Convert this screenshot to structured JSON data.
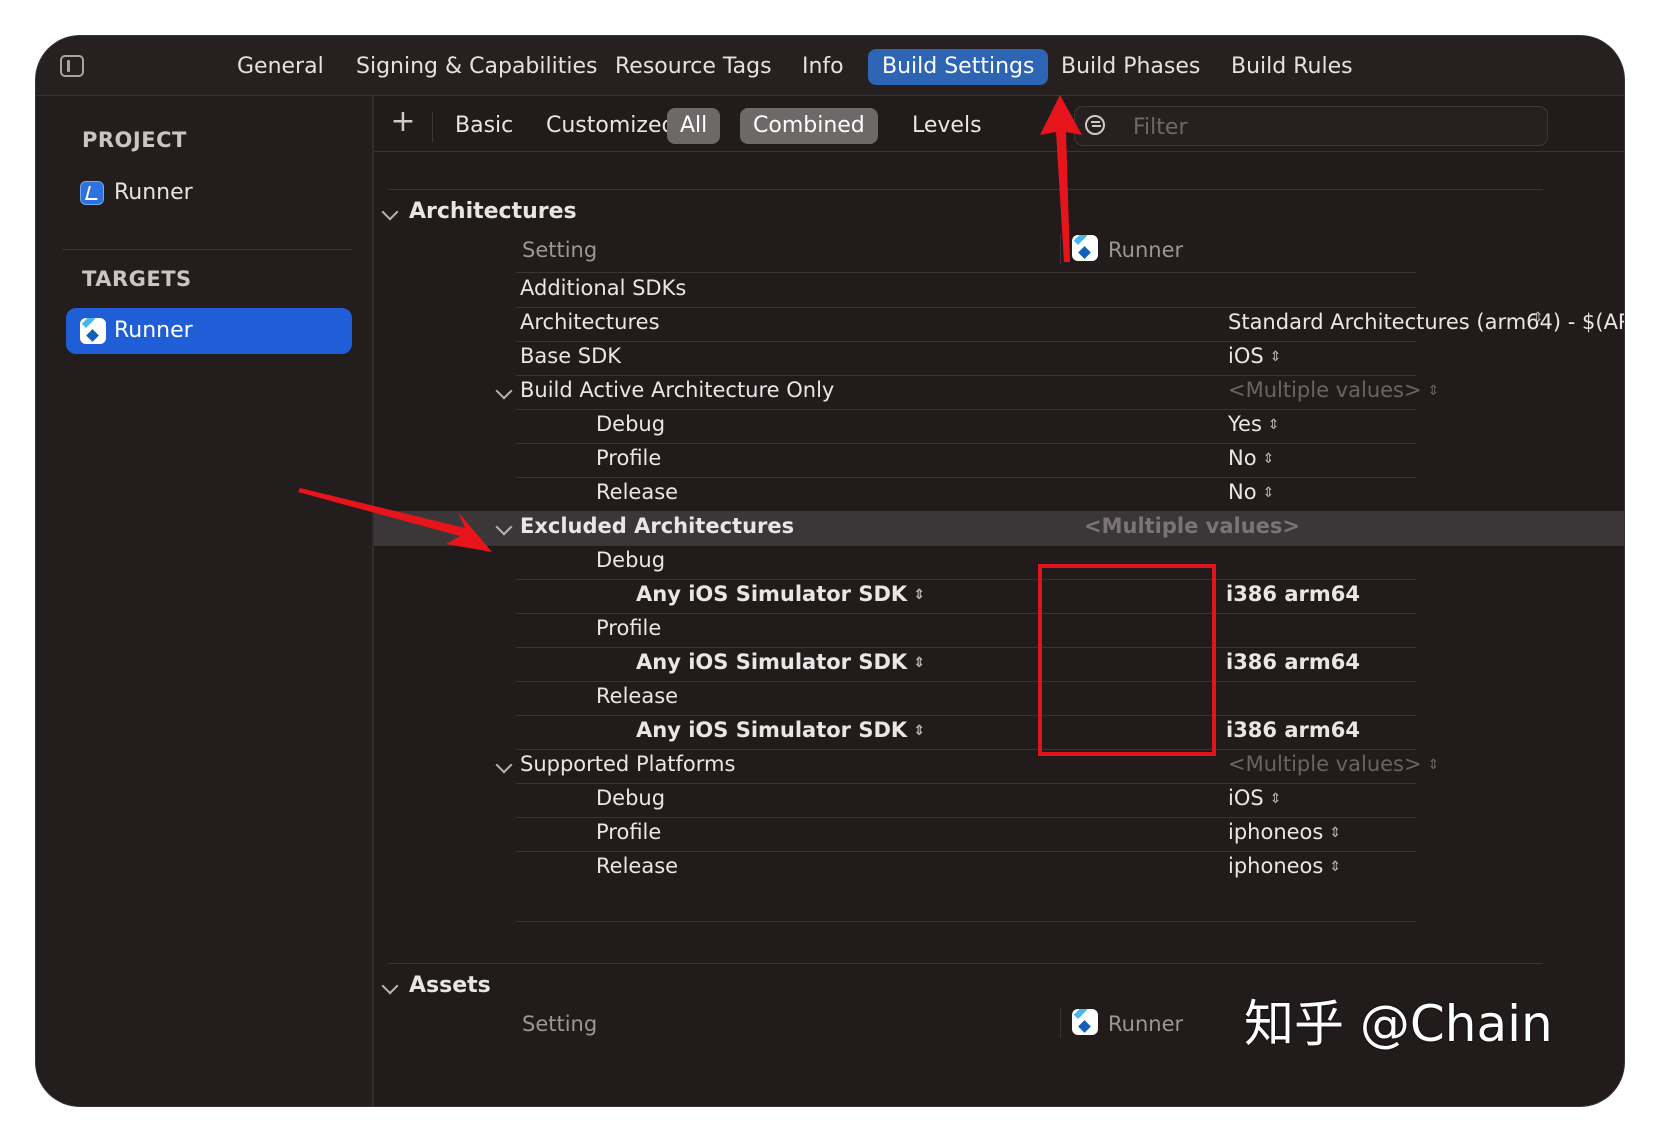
{
  "tabs": [
    "General",
    "Signing & Capabilities",
    "Resource Tags",
    "Info",
    "Build Settings",
    "Build Phases",
    "Build Rules"
  ],
  "sidebar": {
    "project_header": "PROJECT",
    "project_item": "Runner",
    "targets_header": "TARGETS",
    "target_item": "Runner"
  },
  "toolbar": {
    "add": "+",
    "segments": [
      "Basic",
      "Customized",
      "All",
      "Combined",
      "Levels"
    ],
    "filter_placeholder": "Filter"
  },
  "architectures": {
    "title": "Architectures",
    "col_setting": "Setting",
    "col_target": "Runner",
    "rows": [
      {
        "name": "Additional SDKs",
        "value": ""
      },
      {
        "name": "Architectures",
        "value": "Standard Architectures (arm64)  -  $(ARCH..."
      },
      {
        "name": "Base SDK",
        "value": "iOS"
      },
      {
        "name": "Build Active Architecture Only",
        "value": "<Multiple values>"
      },
      {
        "name": "Debug",
        "value": "Yes"
      },
      {
        "name": "Profile",
        "value": "No"
      },
      {
        "name": "Release",
        "value": "No"
      },
      {
        "name": "Excluded Architectures",
        "value": "<Multiple values>"
      },
      {
        "name": "Debug",
        "value": ""
      },
      {
        "name": "Any iOS Simulator SDK",
        "value": "i386 arm64"
      },
      {
        "name": "Profile",
        "value": ""
      },
      {
        "name": "Any iOS Simulator SDK",
        "value": "i386 arm64"
      },
      {
        "name": "Release",
        "value": ""
      },
      {
        "name": "Any iOS Simulator SDK",
        "value": "i386 arm64"
      },
      {
        "name": "Supported Platforms",
        "value": "<Multiple values>"
      },
      {
        "name": "Debug",
        "value": "iOS"
      },
      {
        "name": "Profile",
        "value": "iphoneos"
      },
      {
        "name": "Release",
        "value": "iphoneos"
      }
    ]
  },
  "assets": {
    "title": "Assets",
    "col_setting": "Setting",
    "col_target": "Runner"
  },
  "watermark": "知乎 @Chain",
  "colors": {
    "accent": "#2d64b4",
    "selected": "#1f5ed7",
    "annotation": "#e0141d"
  }
}
